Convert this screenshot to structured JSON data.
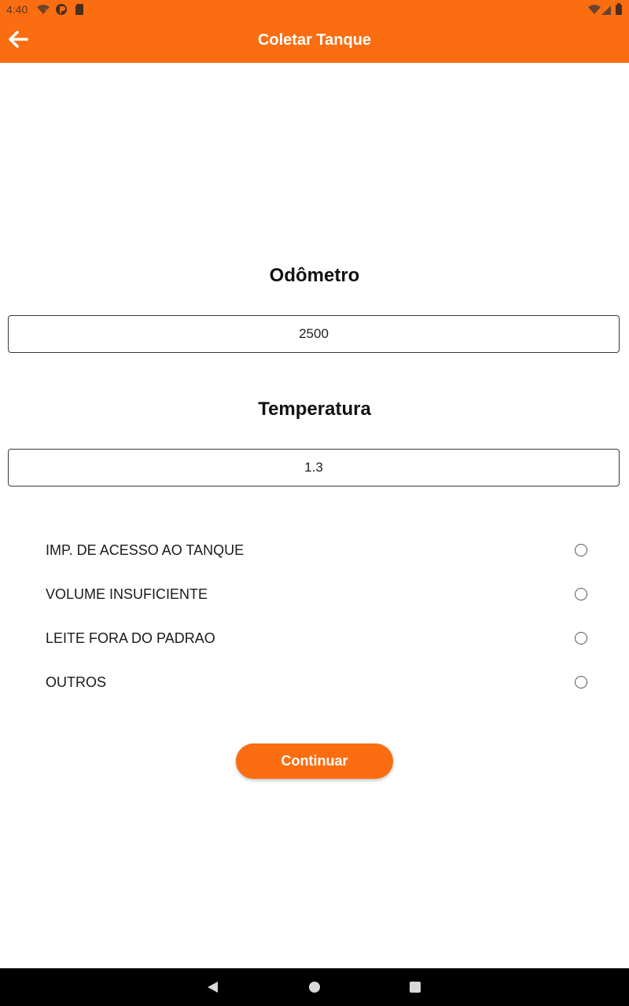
{
  "status_bar": {
    "time": "4:40",
    "icons": [
      "wifi-question-icon",
      "pocket-icon",
      "sd-card-icon",
      "wifi-signal-icon",
      "cell-signal-icon",
      "battery-icon"
    ]
  },
  "app_bar": {
    "title": "Coletar Tanque",
    "back_icon": "arrow-left-icon"
  },
  "form": {
    "odometer_label": "Odômetro",
    "odometer_value": "2500",
    "temperature_label": "Temperatura",
    "temperature_value": "1.3"
  },
  "options": [
    {
      "label": "IMP. DE ACESSO AO TANQUE",
      "selected": false
    },
    {
      "label": "VOLUME INSUFICIENTE",
      "selected": false
    },
    {
      "label": "LEITE FORA DO PADRAO",
      "selected": false
    },
    {
      "label": "OUTROS",
      "selected": false
    }
  ],
  "continue_label": "Continuar",
  "nav": {
    "icons": [
      "back-triangle-icon",
      "home-circle-icon",
      "recents-square-icon"
    ]
  },
  "colors": {
    "accent": "#fb6d11"
  }
}
